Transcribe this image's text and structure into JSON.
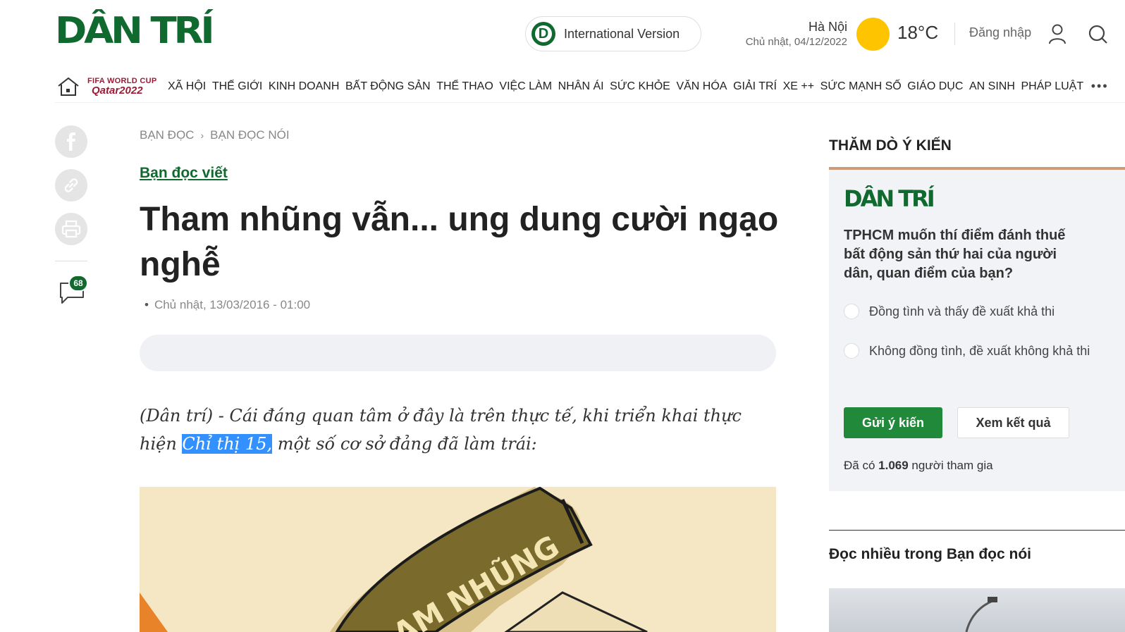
{
  "header": {
    "logo": "DÂN TRÍ",
    "intl_badge": "D",
    "intl_label": "International Version",
    "weather_city": "Hà Nội",
    "weather_date": "Chủ nhật, 04/12/2022",
    "temperature": "18°C",
    "login_label": "Đăng nhập"
  },
  "nav": {
    "worldcup_top": "FIFA WORLD CUP",
    "worldcup_bottom": "Qatar2022",
    "items": [
      "XÃ HỘI",
      "THẾ GIỚI",
      "KINH DOANH",
      "BẤT ĐỘNG SẢN",
      "THỂ THAO",
      "VIỆC LÀM",
      "NHÂN ÁI",
      "SỨC KHỎE",
      "VĂN HÓA",
      "GIẢI TRÍ",
      "XE ++",
      "SỨC MẠNH SỐ",
      "GIÁO DỤC",
      "AN SINH",
      "PHÁP LUẬT"
    ],
    "more": "•••"
  },
  "social": {
    "comment_count": "68"
  },
  "article": {
    "breadcrumb": [
      "BẠN ĐỌC",
      "BẠN ĐỌC NÓI"
    ],
    "breadcrumb_sep": "›",
    "subcategory": "Bạn đọc viết",
    "title": "Tham nhũng vẫn... ung dung cười ngạo nghễ",
    "date": "Chủ nhật, 13/03/2016 - 01:00",
    "sapo_before": "(Dân trí) - Cái đáng quan tâm ở đây là trên thực tế, khi triển khai thực hiện ",
    "sapo_highlight": "Chỉ thị 15,",
    "sapo_after": " một số cơ sở đảng đã làm trái:",
    "image_text": "AM NHŨNG"
  },
  "poll": {
    "heading": "THĂM DÒ Ý KIẾN",
    "logo": "DÂN TRÍ",
    "question": "TPHCM muốn thí điểm đánh thuế bất động sản thứ hai của người dân, quan điểm của bạn?",
    "options": [
      "Đồng tình và thấy đề xuất khả thi",
      "Không đồng tình, đề xuất không khả thi"
    ],
    "vote_label": "Gửi ý kiến",
    "result_label": "Xem kết quả",
    "count_prefix": "Đã có ",
    "count_value": "1.069",
    "count_suffix": " người tham gia"
  },
  "most_read": {
    "heading": "Đọc nhiều trong Bạn đọc nói"
  },
  "colors": {
    "brand_green": "#10692e",
    "vote_green": "#218a3a",
    "worldcup_maroon": "#9b1b34",
    "selection_blue": "#3390ff",
    "sun_yellow": "#ffc400",
    "poll_accent": "#cc9b7a"
  },
  "icons": [
    "home-icon",
    "user-icon",
    "search-icon",
    "facebook-icon",
    "link-icon",
    "print-icon",
    "comment-icon"
  ]
}
